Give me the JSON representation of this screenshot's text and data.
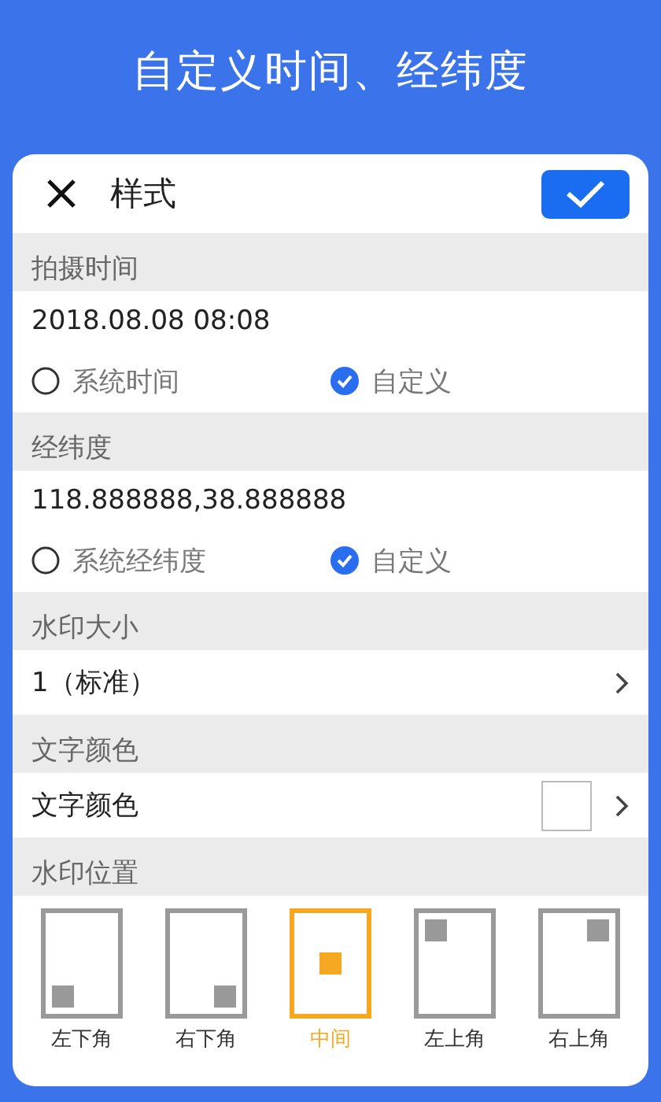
{
  "banner": {
    "title": "自定义时间、经纬度"
  },
  "dialog": {
    "title": "样式"
  },
  "sections": [
    {
      "heading": "拍摄时间",
      "kind": "radios",
      "value": "2018.08.08 08:08",
      "options": [
        {
          "label": "系统时间",
          "selected": false
        },
        {
          "label": "自定义",
          "selected": true
        }
      ]
    },
    {
      "heading": "经纬度",
      "kind": "radios",
      "value": "118.888888,38.888888",
      "options": [
        {
          "label": "系统经纬度",
          "selected": false
        },
        {
          "label": "自定义",
          "selected": true
        }
      ]
    },
    {
      "heading": "水印大小",
      "kind": "select",
      "value": "1（标准）"
    },
    {
      "heading": "文字颜色",
      "kind": "color",
      "value": "文字颜色"
    },
    {
      "heading": "水印位置",
      "kind": "positions",
      "options": [
        {
          "label": "左下角",
          "kind": "bottom-left",
          "selected": false
        },
        {
          "label": "右下角",
          "kind": "bottom-right",
          "selected": false
        },
        {
          "label": "中间",
          "kind": "center",
          "selected": true
        },
        {
          "label": "左上角",
          "kind": "top-left",
          "selected": false
        },
        {
          "label": "右上角",
          "kind": "top-right",
          "selected": false
        }
      ]
    }
  ]
}
